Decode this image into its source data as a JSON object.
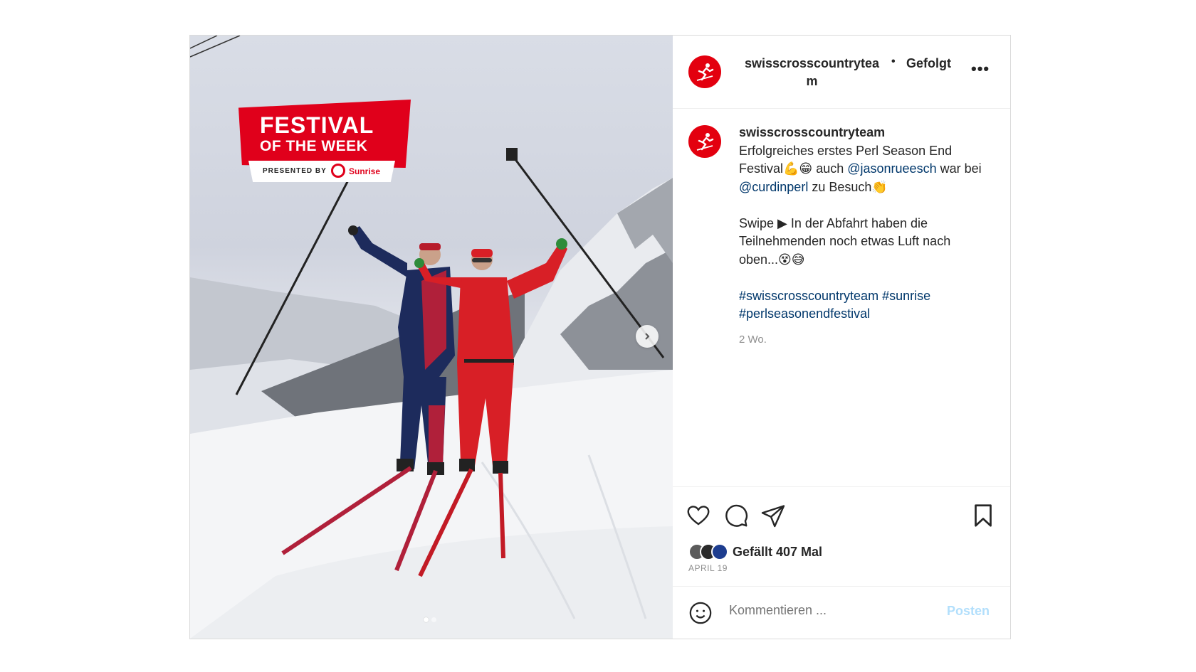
{
  "media": {
    "badge_line1": "FESTIVAL",
    "badge_line2": "OF THE WEEK",
    "badge_presented": "PRESENTED BY",
    "badge_brand": "Sunrise",
    "next_icon": "chevron-right-icon",
    "slide_count": 2,
    "active_slide": 1
  },
  "header": {
    "username": "swisscrosscountryteam",
    "separator": "•",
    "follow_status": "Gefolgt",
    "more": "•••"
  },
  "caption": {
    "username": "swisscrosscountryteam",
    "line1": "Erfolgreiches erstes Perl Season End Festival💪😁 auch ",
    "mention1": "@jasonrueesch",
    "line2a": " war bei ",
    "mention2": "@curdinperl",
    "line2b": " zu Besuch👏",
    "line3": "Swipe ▶ In der Abfahrt haben die Teilnehmenden noch etwas Luft nach oben...😵😅",
    "hashtag1": "#swisscrosscountryteam",
    "hashtag2": "#sunrise",
    "hashtag3": "#perlseasonendfestival",
    "time": "2 Wo."
  },
  "actions": {
    "icons": [
      "heart-icon",
      "comment-icon",
      "share-icon",
      "bookmark-icon"
    ],
    "likes": "Gefällt 407 Mal",
    "date": "APRIL 19"
  },
  "comment": {
    "placeholder": "Kommentieren ...",
    "post_label": "Posten",
    "emoji_icon": "smiley-icon"
  },
  "colors": {
    "brand_red": "#e3000f",
    "link": "#00376b",
    "post_button_disabled": "#b2dffc",
    "muted": "#8e8e8e"
  }
}
